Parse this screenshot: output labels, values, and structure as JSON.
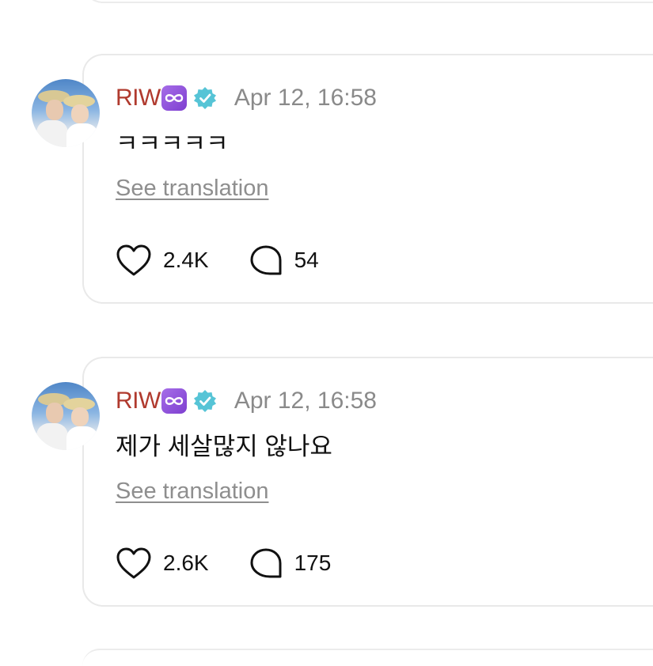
{
  "posts": [
    {
      "username": "RIW",
      "timestamp": "Apr 12, 16:58",
      "text": "ㅋㅋㅋㅋㅋ",
      "see_translation": "See translation",
      "likes": "2.4K",
      "comments": "54"
    },
    {
      "username": "RIW",
      "timestamp": "Apr 12, 16:58",
      "text": "제가 세살많지 않나요",
      "see_translation": "See translation",
      "likes": "2.6K",
      "comments": "175"
    }
  ],
  "colors": {
    "username": "#b03a2e",
    "badge_purple": "#8a4ed8",
    "verified": "#56c4d6",
    "muted": "#8e8e8e"
  },
  "icons": [
    "infinity-badge-icon",
    "verified-icon",
    "heart-icon",
    "comment-icon"
  ]
}
